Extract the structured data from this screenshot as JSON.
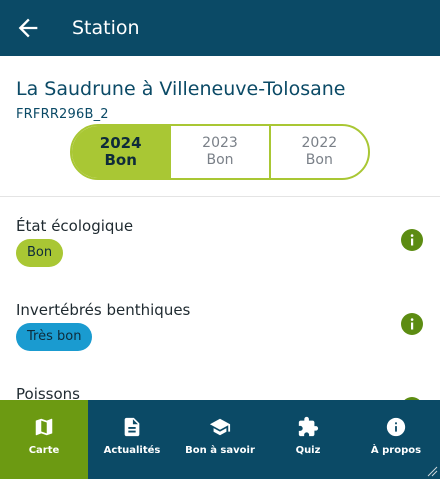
{
  "appbar": {
    "title": "Station"
  },
  "station": {
    "name": "La Saudrune à Villeneuve-Tolosane",
    "code": "FRFRR296B_2"
  },
  "years": [
    {
      "year": "2024",
      "status": "Bon"
    },
    {
      "year": "2023",
      "status": "Bon"
    },
    {
      "year": "2022",
      "status": "Bon"
    }
  ],
  "selected_year": "2024",
  "indicators": [
    {
      "label": "État écologique",
      "value": "Bon",
      "color": "#a9c734"
    },
    {
      "label": "Invertébrés benthiques",
      "value": "Très bon",
      "color": "#1a9bd0"
    },
    {
      "label": "Poissons",
      "value": ""
    }
  ],
  "bottom_nav": [
    {
      "label": "Carte",
      "icon": "map-icon",
      "active": true
    },
    {
      "label": "Actualités",
      "icon": "article-icon"
    },
    {
      "label": "Bon à savoir",
      "icon": "school-icon"
    },
    {
      "label": "Quiz",
      "icon": "puzzle-icon"
    },
    {
      "label": "À propos",
      "icon": "info-icon"
    }
  ],
  "colors": {
    "primary": "#0b4a66",
    "accent": "#a9c734",
    "active_nav": "#6c9a12",
    "info_icon": "#5c8c12"
  }
}
